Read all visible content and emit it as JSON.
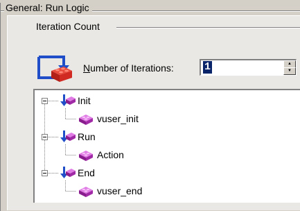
{
  "general_group": {
    "title": "General: Run Logic"
  },
  "iteration_group": {
    "title": "Iteration Count"
  },
  "iterations": {
    "label_accelerator": "N",
    "label_rest": "umber of Iterations:",
    "value": "1"
  },
  "icons": {
    "iterations": "loop-arrow-brick-icon",
    "section": "blue-arrow-brick-icon",
    "action": "purple-brick-icon",
    "expander": "minus-box-icon"
  },
  "colors": {
    "window_bg": "#d4d0c8",
    "panel_bg": "#e9e8e4",
    "selection": "#0a246a",
    "brick_purple": "#a12aa6",
    "arrow_blue": "#1f4ec8"
  },
  "tree": {
    "sections": [
      {
        "label": "Init",
        "actions": [
          {
            "label": "vuser_init"
          }
        ]
      },
      {
        "label": "Run",
        "actions": [
          {
            "label": "Action"
          }
        ]
      },
      {
        "label": "End",
        "actions": [
          {
            "label": "vuser_end"
          }
        ]
      }
    ]
  }
}
